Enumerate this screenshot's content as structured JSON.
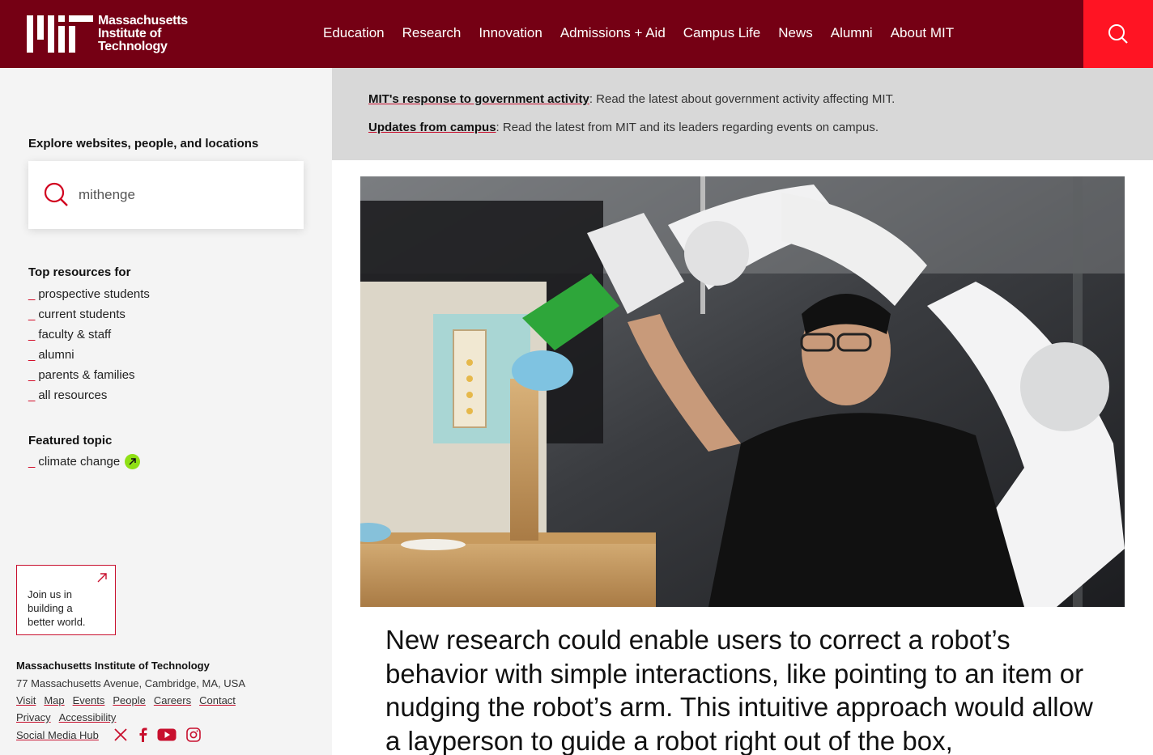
{
  "header": {
    "logo_text": [
      "Massachusetts",
      "Institute of",
      "Technology"
    ],
    "nav": [
      "Education",
      "Research",
      "Innovation",
      "Admissions + Aid",
      "Campus Life",
      "News",
      "Alumni",
      "About MIT"
    ],
    "brand_color": "#750014",
    "search_button_color": "#ff1423"
  },
  "sidebar": {
    "explore_heading": "Explore websites, people, and locations",
    "search_value": "mithenge",
    "top_resources_heading": "Top resources for",
    "resources": [
      "prospective students",
      "current students",
      "faculty & staff",
      "alumni",
      "parents & families",
      "all resources"
    ],
    "featured_heading": "Featured topic",
    "featured_item": "climate change",
    "join_text": [
      "Join us in",
      "building a",
      "better world."
    ],
    "footer": {
      "title": "Massachusetts Institute of Technology",
      "address": "77 Massachusetts Avenue, Cambridge, MA, USA",
      "links_row1": [
        "Visit",
        "Map",
        "Events",
        "People",
        "Careers",
        "Contact"
      ],
      "links_row2": [
        "Privacy",
        "Accessibility"
      ],
      "social_hub": "Social Media Hub",
      "social_icons": [
        "x-icon",
        "facebook-icon",
        "youtube-icon",
        "instagram-icon"
      ]
    }
  },
  "alerts": [
    {
      "link": "MIT's response to government activity",
      "text": ": Read the latest about government activity affecting MIT."
    },
    {
      "link": "Updates from campus",
      "text": ": Read the latest from MIT and its leaders regarding events on campus."
    }
  ],
  "hero": {
    "headline": "New research could enable users to correct a robot’s behavior with simple interactions, like pointing to an item or nudging the robot’s arm. This intuitive approach would allow a layperson to guide a robot right out of the box,"
  }
}
